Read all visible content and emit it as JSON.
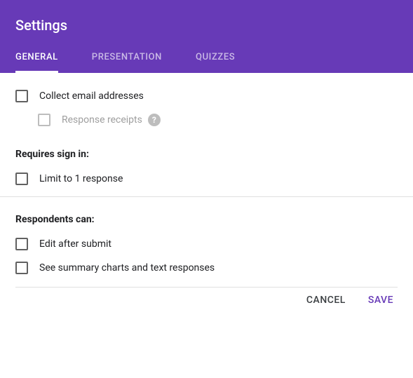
{
  "header": {
    "title": "Settings",
    "tabs": [
      {
        "label": "GENERAL",
        "active": true
      },
      {
        "label": "PRESENTATION",
        "active": false
      },
      {
        "label": "QUIZZES",
        "active": false
      }
    ]
  },
  "options": {
    "collect_email": "Collect email addresses",
    "response_receipts": "Response receipts"
  },
  "section_requires": {
    "title": "Requires sign in:",
    "limit": "Limit to 1 response"
  },
  "section_respondents": {
    "title": "Respondents can:",
    "edit": "Edit after submit",
    "summary": "See summary charts and text responses"
  },
  "footer": {
    "cancel": "CANCEL",
    "save": "SAVE"
  }
}
